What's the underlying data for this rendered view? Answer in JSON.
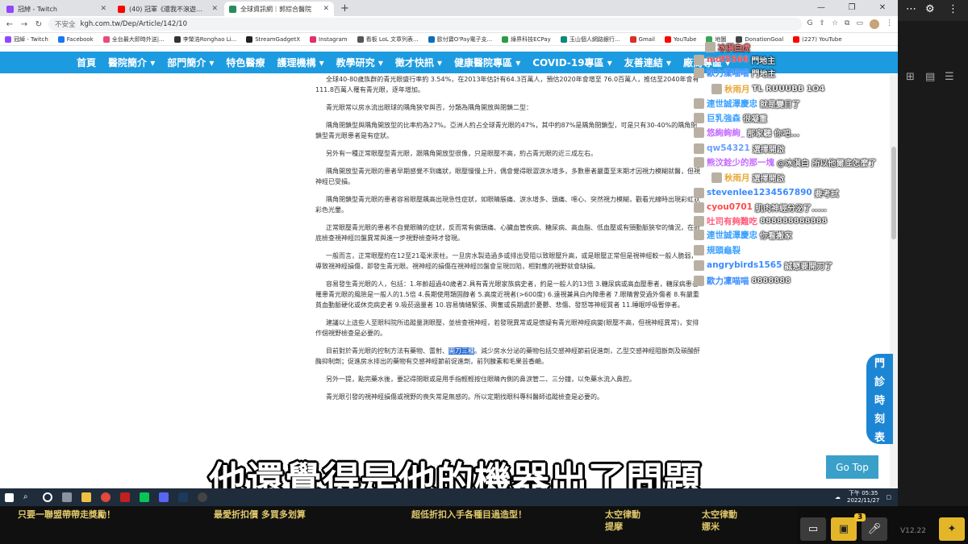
{
  "browser": {
    "tabs": [
      {
        "title": "冠綽 - Twitch",
        "color": "#9146ff"
      },
      {
        "title": "(40) 冠軍《還我不滾遊》遊戲...",
        "color": "#ff0000"
      },
      {
        "title": "全球資訊網｜郭綜合醫院",
        "color": "#2a8c5a"
      }
    ],
    "url_security": "不安全",
    "url": "kgh.com.tw/Dep/Article/142/10",
    "bookmarks": [
      {
        "label": "冠綽 - Twitch",
        "color": "#9146ff"
      },
      {
        "label": "Facebook",
        "color": "#1877f2"
      },
      {
        "label": "全台最大即時外送|...",
        "color": "#e94b7b"
      },
      {
        "label": "李榮浩Ronghao Li...",
        "color": "#333333"
      },
      {
        "label": "StreamGadgetX",
        "color": "#222222"
      },
      {
        "label": "Instagram",
        "color": "#e1306c"
      },
      {
        "label": "看板 LoL 文章列表...",
        "color": "#555555"
      },
      {
        "label": "歐付寶O'Pay電子支...",
        "color": "#0a6ebd"
      },
      {
        "label": "綠界科技ECPay",
        "color": "#2e9b44"
      },
      {
        "label": "玉山個人網路銀行...",
        "color": "#0a8a7b"
      },
      {
        "label": "Gmail",
        "color": "#d93025"
      },
      {
        "label": "YouTube",
        "color": "#ff0000"
      },
      {
        "label": "地圖",
        "color": "#34a853"
      },
      {
        "label": "DonationGoal",
        "color": "#444444"
      },
      {
        "label": "(227) YouTube",
        "color": "#ff0000"
      }
    ]
  },
  "site_nav": [
    "首頁",
    "醫院簡介 ▾",
    "部門簡介 ▾",
    "特色醫療",
    "護理機構 ▾",
    "教學研究 ▾",
    "徵才快訊 ▾",
    "健康醫院專區 ▾",
    "COVID-19專區 ▾",
    "友善連結 ▾",
    "廠商專區 ▾"
  ],
  "article": {
    "paragraphs": [
      {
        "text": "全球40-80歲族群的青光眼盛行率約 3.54%，在2013年估計有64.3百萬人，預估2020年會增至 76.0百萬人，推估至2040年會有111.8百萬人罹有青光眼，逐年增加。"
      },
      {
        "text": "青光眼常以房水流出眼球的隅角狹窄與否，分類為隅角開放與閉鎖二型："
      },
      {
        "text": "隅角閉鎖型與隅角開放型的比率約為27%。亞洲人約占全球青光眼的47%，其中約87%是隅角閉鎖型，可是只有30-40%的隅角閉鎖型青光眼患者是有症狀。"
      },
      {
        "text": "另外有一種正常眼壓型青光眼，跟隅角開放型很像，只是眼壓不高，約占青光眼的近三成左右。"
      },
      {
        "text": "隅角開放型青光眼的患者早期感覺不到痛狀，眼壓慢慢上升，偶會覺得眼澀淚水增多，多數患者嚴重至末期才因視力模糊就醫，但視神經已受損。"
      },
      {
        "text": "隅角閉鎖型青光眼的患者容易眼壓飆高出現急性症狀，如眼睛脹痛、淚水增多、頭痛、噁心、突然視力模糊，觀看光線時出現彩虹狀彩色光暈。"
      },
      {
        "text": "正常眼壓青光眼的患者不自覺眼睛的症狀，反而常有偏頭痛、心臟血管疾病、糖尿病、高血脂、低血壓或有頸動脈狹窄的情況，在眼底檢查視神經凹盤異常與進一步視野檢查時才發現。"
      },
      {
        "text": "一般而言，正常眼壓約在12至21毫米汞柱。一旦房水製造過多或排出受阻以致眼壓升高，或是眼壓正常但是視神經較一般人脆弱，導致視神經損傷，即發生青光眼。視神經的損傷在視神經凹盤會呈現凹陷，相對應的視野就會缺損。"
      },
      {
        "text": "容易發生青光眼的人，包括：1.年齡超過40歲者2.具有青光眼家族病史者，約是一般人的13倍 3.糖尿病或高血壓患者，糖尿病患者罹患青光眼的風險是一般人的1.5倍 4.長期使用類固醇者 5.高度近視者(>600度) 6.遠視兼具白內障患者 7.眼睛曾受過外傷者 8.有嚴重貧血動脈硬化或休克病史者 9.吸菸過量者 10.容易情緒緊張、興奮或長期處於憂鬱、悲傷、發怒等神經質者 11.睡眠呼吸暫停者。"
      },
      {
        "text": "建議以上這些人至眼科院所追蹤量測眼壓，並檢查視神經，若發現異常或是懷疑有青光眼神經病變(眼壓不高，但視神經異常)，安排作個視野檢查是必要的。"
      },
      {
        "pre": "目前對於青光眼的控制方法有藥物、雷射、",
        "highlight": "開刀三種",
        "post": "。減少房水分泌的藥物包括交感神經節前促進劑，乙型交感神經阻斷劑及碳酸酐酶抑制劑；促進房水排出的藥物有交感神經節前促進劑，前列腺素和毛果芸香鹼。"
      },
      {
        "text": "另外一提，點完藥水後，要記得閉眼或是用手指輕輕按住眼睛內側的鼻淚管二、三分鐘，以免藥水流入鼻腔。"
      },
      {
        "text": "青光眼引發的視神經損傷或視野的喪失常是無感的。所以定期找眼科專科醫師追蹤檢查是必要的。"
      }
    ]
  },
  "side_button": {
    "chars": [
      "門",
      "診",
      "時",
      "刻",
      "表"
    ]
  },
  "gotop_label": "Go Top",
  "chat": [
    {
      "user": "",
      "msg": "冰淇白虎",
      "user_color": "#ff7a7a"
    },
    {
      "user": "mdf5566",
      "msg": "門地主",
      "user_color": "#ff4a4a"
    },
    {
      "user": "歐力凜喵喵",
      "msg": "門地主",
      "user_color": "#3a8bff"
    },
    {
      "user": "秋雨月",
      "msg": "TL RUUUBB 1O4",
      "user_color": "#e8a83a"
    },
    {
      "user": "連世誠澤慶忠",
      "msg": "就是變目了",
      "user_color": "#3aa0ff"
    },
    {
      "user": "巨乳強森",
      "msg": "很凝重",
      "user_color": "#3aa0ff"
    },
    {
      "user": "悠絢絢絢_",
      "msg": "那家聽 你吧...",
      "user_color": "#c46aff"
    },
    {
      "user": "qw54321",
      "msg": "選擇開啟",
      "user_color": "#6a9eff"
    },
    {
      "user": "熊汶銓少的那一塊",
      "msg": "@冰淇白 所以他爾底怎麼了",
      "user_color": "#c46aff"
    },
    {
      "user": "秋雨月",
      "msg": "選擇開啟",
      "user_color": "#e8a83a"
    },
    {
      "user": "stevenlee1234567890",
      "msg": "要考試",
      "user_color": "#3a8bff"
    },
    {
      "user": "cyou0701",
      "msg": "肌肉神經分泌了.....",
      "user_color": "#ff4a4a"
    },
    {
      "user": "吐司有夠難吃",
      "msg": "888888888888",
      "user_color": "#ff5a7a"
    },
    {
      "user": "連世誠澤慶忠",
      "msg": "你看搬家",
      "user_color": "#3aa0ff"
    },
    {
      "user": "規頭龜裂",
      "msg": "",
      "user_color": "#3aa0ff"
    },
    {
      "user": "angrybirds1565",
      "msg": "誠懇要開刀了",
      "user_color": "#3a8bff"
    },
    {
      "user": "歐力凜喵喵",
      "msg": "8888888",
      "user_color": "#3a8bff"
    }
  ],
  "subtitle": "他還覺得是他的機器出了問題",
  "taskbar": {
    "time": "下午 05:35",
    "date": "2022/11/27"
  },
  "ticker": [
    "只要一聯盟帶帶走獎勵！",
    "最愛折扣價 多買多划算",
    "超低折扣入手各種目過造型！",
    "太空律動",
    "提摩",
    "太空律動",
    "娜米"
  ],
  "bottom": {
    "badge": "3",
    "version": "V12.22"
  }
}
